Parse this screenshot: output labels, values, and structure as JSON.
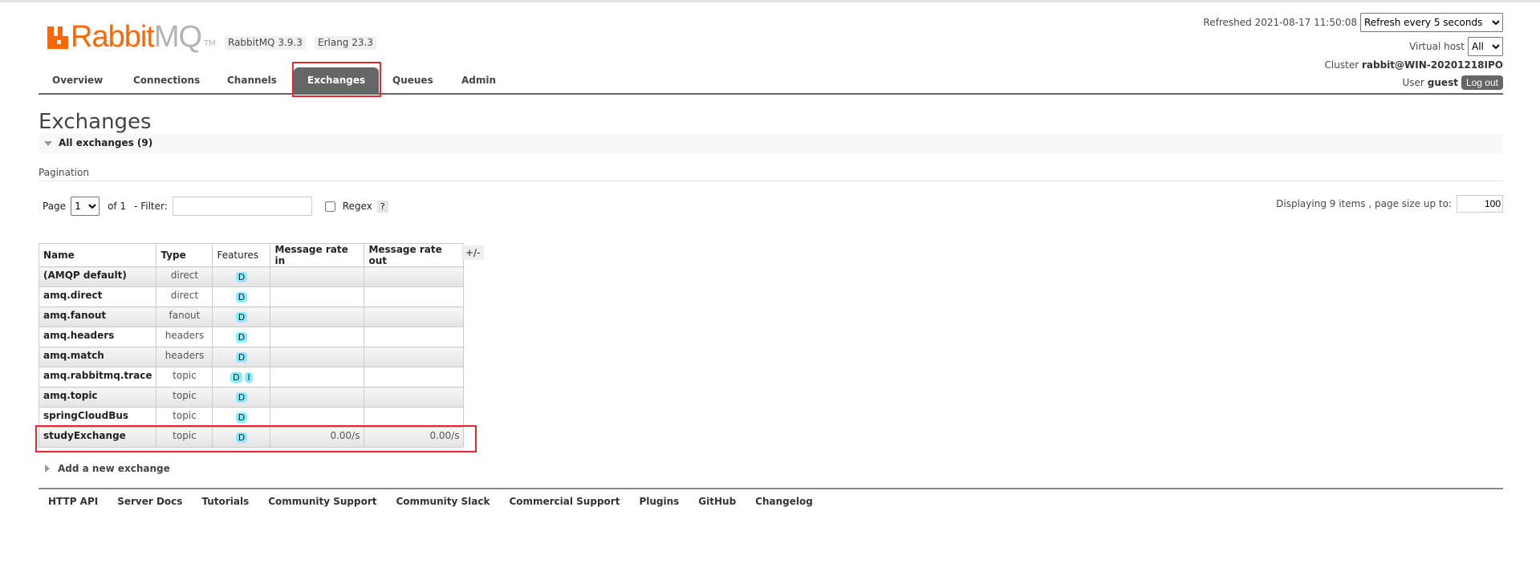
{
  "logo": {
    "text_orange": "Rabbit",
    "text_grey": "MQ",
    "tm": "TM"
  },
  "versions": {
    "rabbitmq": "RabbitMQ 3.9.3",
    "erlang": "Erlang 23.3"
  },
  "tabs": [
    {
      "label": "Overview"
    },
    {
      "label": "Connections"
    },
    {
      "label": "Channels"
    },
    {
      "label": "Exchanges",
      "active": true
    },
    {
      "label": "Queues"
    },
    {
      "label": "Admin"
    }
  ],
  "header_right": {
    "refreshed": "Refreshed 2021-08-17 11:50:08",
    "refresh_option": "Refresh every 5 seconds",
    "vhost_label": "Virtual host",
    "vhost_value": "All",
    "cluster_label": "Cluster",
    "cluster_value": "rabbit@WIN-20201218IPO",
    "user_label": "User",
    "user_value": "guest",
    "logout": "Log out"
  },
  "page_title": "Exchanges",
  "section_title": "All exchanges (9)",
  "pagination": {
    "label": "Pagination",
    "page_label": "Page",
    "page_value": "1",
    "of": "of 1",
    "filter_label": "- Filter:",
    "filter_value": "",
    "regex_label": "Regex",
    "help": "?",
    "displaying": "Displaying 9 items , page size up to:",
    "page_size": "100"
  },
  "table": {
    "headers": [
      "Name",
      "Type",
      "Features",
      "Message rate in",
      "Message rate out"
    ],
    "toggle": "+/-",
    "rows": [
      {
        "name": "(AMQP default)",
        "type": "direct",
        "features": [
          "D"
        ],
        "in": "",
        "out": ""
      },
      {
        "name": "amq.direct",
        "type": "direct",
        "features": [
          "D"
        ],
        "in": "",
        "out": ""
      },
      {
        "name": "amq.fanout",
        "type": "fanout",
        "features": [
          "D"
        ],
        "in": "",
        "out": ""
      },
      {
        "name": "amq.headers",
        "type": "headers",
        "features": [
          "D"
        ],
        "in": "",
        "out": ""
      },
      {
        "name": "amq.match",
        "type": "headers",
        "features": [
          "D"
        ],
        "in": "",
        "out": ""
      },
      {
        "name": "amq.rabbitmq.trace",
        "type": "topic",
        "features": [
          "D",
          "I"
        ],
        "in": "",
        "out": ""
      },
      {
        "name": "amq.topic",
        "type": "topic",
        "features": [
          "D"
        ],
        "in": "",
        "out": ""
      },
      {
        "name": "springCloudBus",
        "type": "topic",
        "features": [
          "D"
        ],
        "in": "",
        "out": ""
      },
      {
        "name": "studyExchange",
        "type": "topic",
        "features": [
          "D"
        ],
        "in": "0.00/s",
        "out": "0.00/s"
      }
    ]
  },
  "add_exchange": "Add a new exchange",
  "footer": [
    "HTTP API",
    "Server Docs",
    "Tutorials",
    "Community Support",
    "Community Slack",
    "Commercial Support",
    "Plugins",
    "GitHub",
    "Changelog"
  ],
  "colors": {
    "brand": "#ff6600",
    "tab_active": "#666666",
    "feature_pill": "#88eeff",
    "highlight": "#e8262d"
  }
}
